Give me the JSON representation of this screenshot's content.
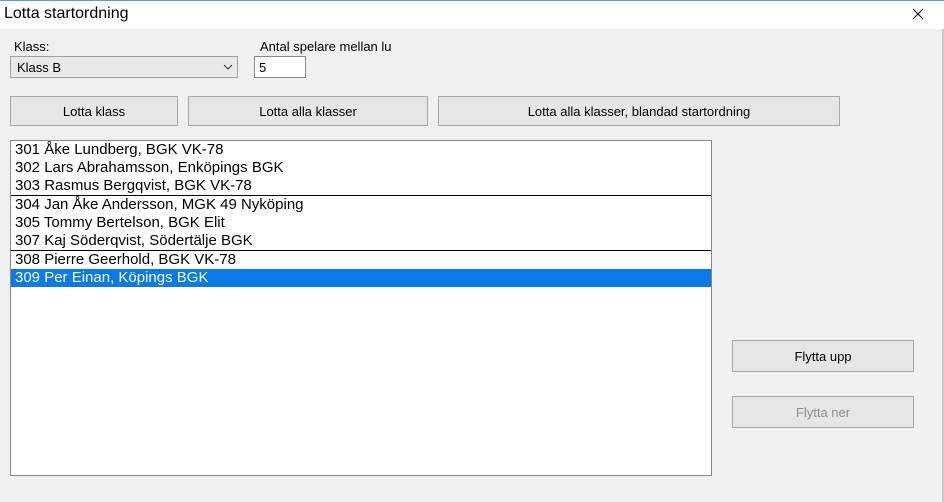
{
  "window": {
    "title": "Lotta startordning"
  },
  "labels": {
    "klass": "Klass:",
    "antal": "Antal spelare mellan lu"
  },
  "klass_select": {
    "value": "Klass B"
  },
  "antal_input": {
    "value": "5"
  },
  "buttons": {
    "lotta_klass": "Lotta klass",
    "lotta_alla": "Lotta alla klasser",
    "lotta_blandad": "Lotta alla klasser, blandad startordning",
    "flytta_upp": "Flytta upp",
    "flytta_ner": "Flytta ner"
  },
  "list": {
    "groups": [
      {
        "items": [
          {
            "text": "301 Åke Lundberg, BGK VK-78",
            "selected": false
          },
          {
            "text": "302 Lars Abrahamsson, Enköpings BGK",
            "selected": false
          },
          {
            "text": "303 Rasmus Bergqvist, BGK VK-78",
            "selected": false
          }
        ]
      },
      {
        "items": [
          {
            "text": "304 Jan Åke Andersson, MGK 49 Nyköping",
            "selected": false
          },
          {
            "text": "305 Tommy Bertelson, BGK Elit",
            "selected": false
          },
          {
            "text": "307 Kaj Söderqvist, Södertälje BGK",
            "selected": false
          }
        ]
      },
      {
        "items": [
          {
            "text": "308 Pierre Geerhold, BGK VK-78",
            "selected": false
          },
          {
            "text": "309 Per Einan, Köpings BGK",
            "selected": true
          }
        ]
      }
    ]
  }
}
